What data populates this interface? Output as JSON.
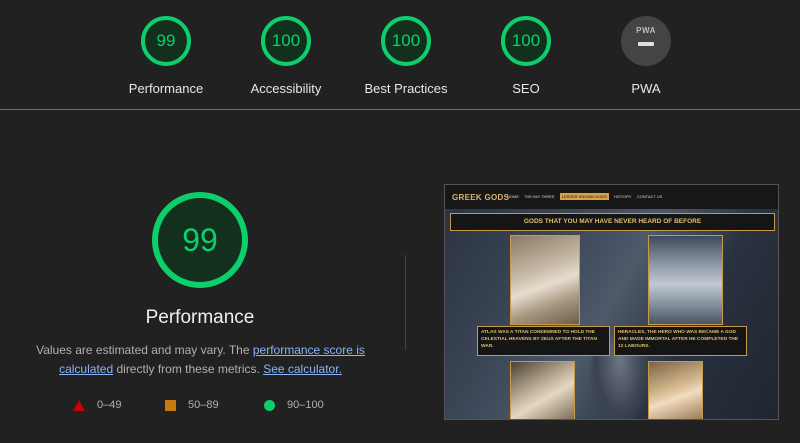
{
  "scores": [
    {
      "value": "99",
      "label": "Performance"
    },
    {
      "value": "100",
      "label": "Accessibility"
    },
    {
      "value": "100",
      "label": "Best Practices"
    },
    {
      "value": "100",
      "label": "SEO"
    }
  ],
  "pwa": {
    "badge": "PWA",
    "label": "PWA"
  },
  "main": {
    "score": "99",
    "title": "Performance",
    "desc_pre": "Values are estimated and may vary. The ",
    "desc_link1": "performance score is calculated",
    "desc_mid": " directly from these metrics. ",
    "desc_link2": "See calculator."
  },
  "legend": {
    "fail": "0–49",
    "average": "50–89",
    "pass": "90–100"
  },
  "colors": {
    "pass": "#0cce6b",
    "average": "#c57a12",
    "fail": "#cc0000",
    "link": "#8ab4f8"
  },
  "screenshot": {
    "logo": "GREEK GODS",
    "nav": [
      "HOME",
      "THE BIG THREE",
      "LESSER KNOWN GODS",
      "HISTORY",
      "CONTACT US"
    ],
    "banner": "GODS THAT YOU MAY HAVE NEVER HEARD OF BEFORE",
    "caption1": "ATLAS WAS A TITAN CONDEMNED TO HOLD THE CELESTIAL HEAVENS BY ZEUS AFTER THE TITAN WAR.",
    "caption2": "HERACLES, THE HERO WHO WAS BECAME A GOD AND MADE IMMORTAL AFTER HE COMPLETED THE 12 LABOURS."
  }
}
